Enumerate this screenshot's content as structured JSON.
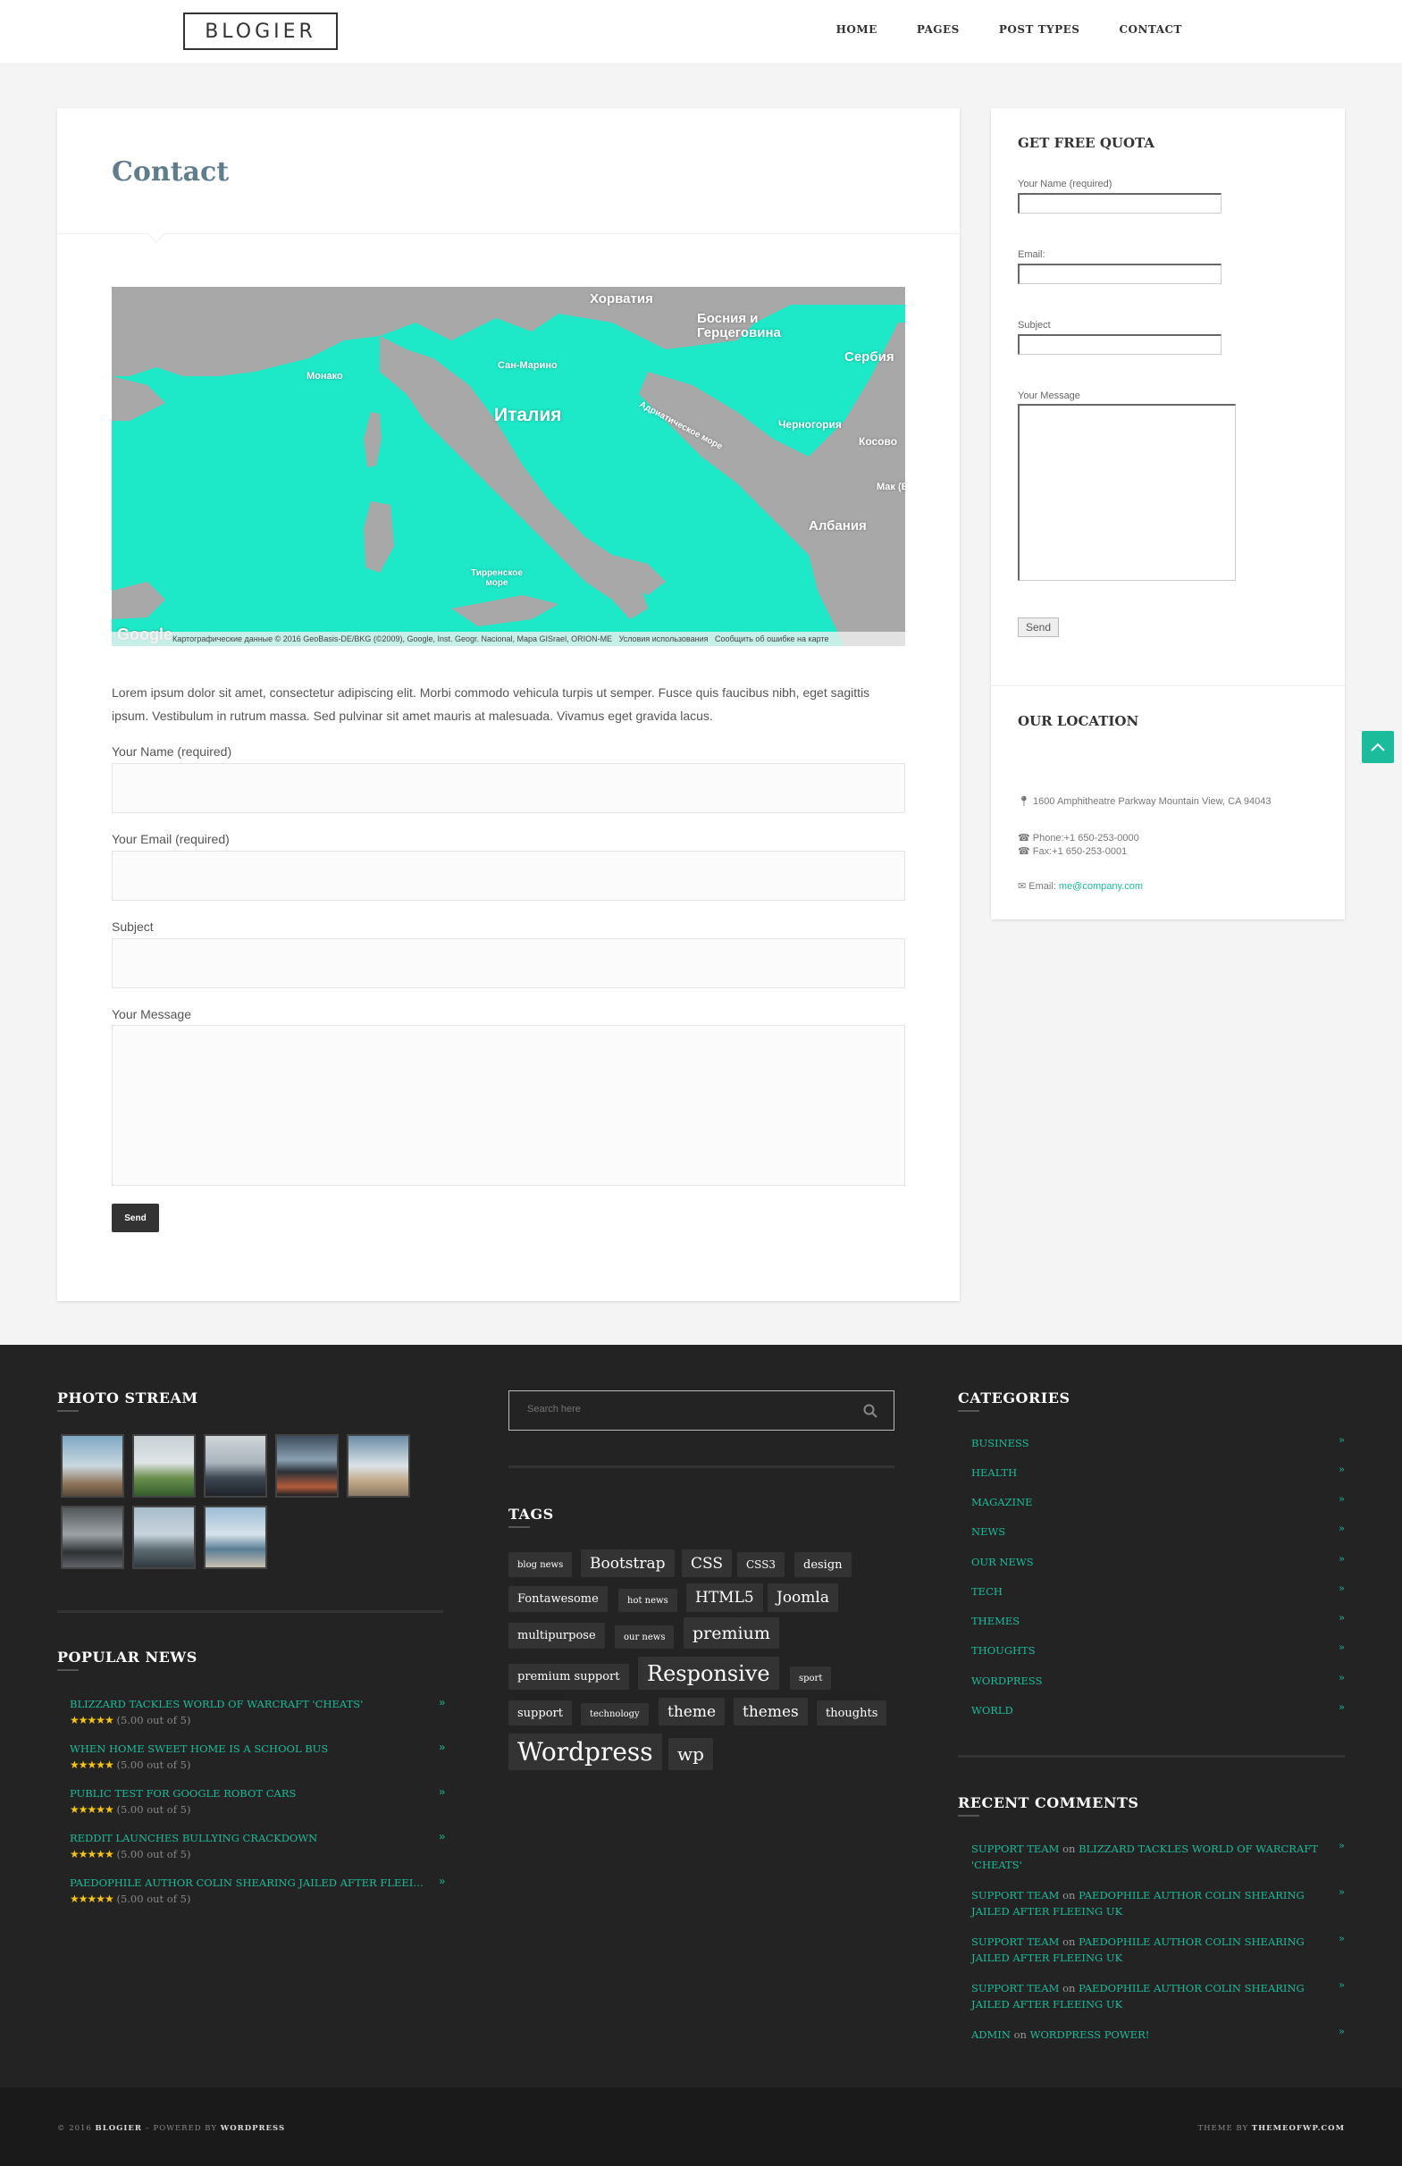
{
  "header": {
    "logo": "BLOGIER",
    "nav": [
      "HOME",
      "PAGES",
      "POST TYPES",
      "CONTACT"
    ]
  },
  "main": {
    "title": "Contact",
    "map": {
      "labels": [
        "Хорватия",
        "Босния и Герцеговина",
        "Сербия",
        "Монако",
        "Сан-Марино",
        "Италия",
        "Адриатическое море",
        "Черногория",
        "Косово",
        "Албания",
        "Тирренское море",
        "Мак (Б"
      ],
      "google": "Google",
      "attribution": "Картографические данные © 2016 GeoBasis-DE/BKG (©2009), Google, Inst. Geogr. Nacional, Mapa GISrael, ORION-ME",
      "terms": "Условия использования",
      "report": "Сообщить об ошибке на карте"
    },
    "intro": "Lorem ipsum dolor sit amet, consectetur adipiscing elit. Morbi commodo vehicula turpis ut semper. Fusce quis faucibus nibh, eget sagittis ipsum. Vestibulum in rutrum massa. Sed pulvinar sit amet mauris at malesuada. Vivamus eget gravida lacus.",
    "form": {
      "name_label": "Your Name (required)",
      "email_label": "Your Email (required)",
      "subject_label": "Subject",
      "message_label": "Your Message",
      "send": "Send"
    }
  },
  "sidebar": {
    "quota_title": "GET FREE QUOTA",
    "name_label": "Your Name (required)",
    "email_label": "Email:",
    "subject_label": "Subject",
    "message_label": "Your Message",
    "send": "Send",
    "location_title": "OUR LOCATION",
    "address": "1600 Amphitheatre Parkway Mountain View, CA 94043",
    "phone": "Phone:+1 650-253-0000",
    "fax": "Fax:+1 650-253-0001",
    "email": "me@company.com"
  },
  "footer": {
    "photo_stream_title": "PHOTO STREAM",
    "popular_news_title": "POPULAR NEWS",
    "popular_news": [
      {
        "title": "BLIZZARD TACKLES WORLD OF WARCRAFT 'CHEATS'",
        "rating": "(5.00 out of 5)"
      },
      {
        "title": "WHEN HOME SWEET HOME IS A SCHOOL BUS",
        "rating": "(5.00 out of 5)"
      },
      {
        "title": "PUBLIC TEST FOR GOOGLE ROBOT CARS",
        "rating": "(5.00 out of 5)"
      },
      {
        "title": "REDDIT LAUNCHES BULLYING CRACKDOWN",
        "rating": "(5.00 out of 5)"
      },
      {
        "title": "PAEDOPHILE AUTHOR COLIN SHEARING JAILED AFTER FLEEING U...",
        "rating": "(5.00 out of 5)"
      }
    ],
    "search_placeholder": "Search here",
    "tags_title": "TAGS",
    "tags": [
      "blog news",
      "Bootstrap",
      "CSS",
      "CSS3",
      "design",
      "Fontawesome",
      "hot news",
      "HTML5",
      "Joomla",
      "multipurpose",
      "our news",
      "premium",
      "premium support",
      "Responsive",
      "sport",
      "support",
      "technology",
      "theme",
      "themes",
      "thoughts",
      "Wordpress",
      "wp"
    ],
    "categories_title": "CATEGORIES",
    "categories": [
      "BUSINESS",
      "HEALTH",
      "MAGAZINE",
      "NEWS",
      "OUR NEWS",
      "TECH",
      "THEMES",
      "THOUGHTS",
      "WORDPRESS",
      "WORLD"
    ],
    "recent_comments_title": "RECENT COMMENTS",
    "recent_comments": [
      {
        "author": "SUPPORT TEAM",
        "on": "on",
        "post": "BLIZZARD TACKLES WORLD OF WARCRAFT 'CHEATS'"
      },
      {
        "author": "SUPPORT TEAM",
        "on": "on",
        "post": "PAEDOPHILE AUTHOR COLIN SHEARING JAILED AFTER FLEEING UK"
      },
      {
        "author": "SUPPORT TEAM",
        "on": "on",
        "post": "PAEDOPHILE AUTHOR COLIN SHEARING JAILED AFTER FLEEING UK"
      },
      {
        "author": "SUPPORT TEAM",
        "on": "on",
        "post": "PAEDOPHILE AUTHOR COLIN SHEARING JAILED AFTER FLEEING UK"
      },
      {
        "author": "ADMIN",
        "on": "on",
        "post": "WORDPRESS POWER!"
      }
    ],
    "copyright_prefix": "© 2016",
    "copyright_brand": "BLOGIER",
    "copyright_mid": "– POWERED BY",
    "copyright_platform": "WORDPRESS",
    "theme_by": "THEME BY",
    "theme_site": "THEMEOFWP.COM"
  },
  "colors": {
    "accent": "#1abc9c",
    "title_blue": "#5f7d8c",
    "footer_bg": "#232323",
    "map_water": "#1de9c8"
  }
}
